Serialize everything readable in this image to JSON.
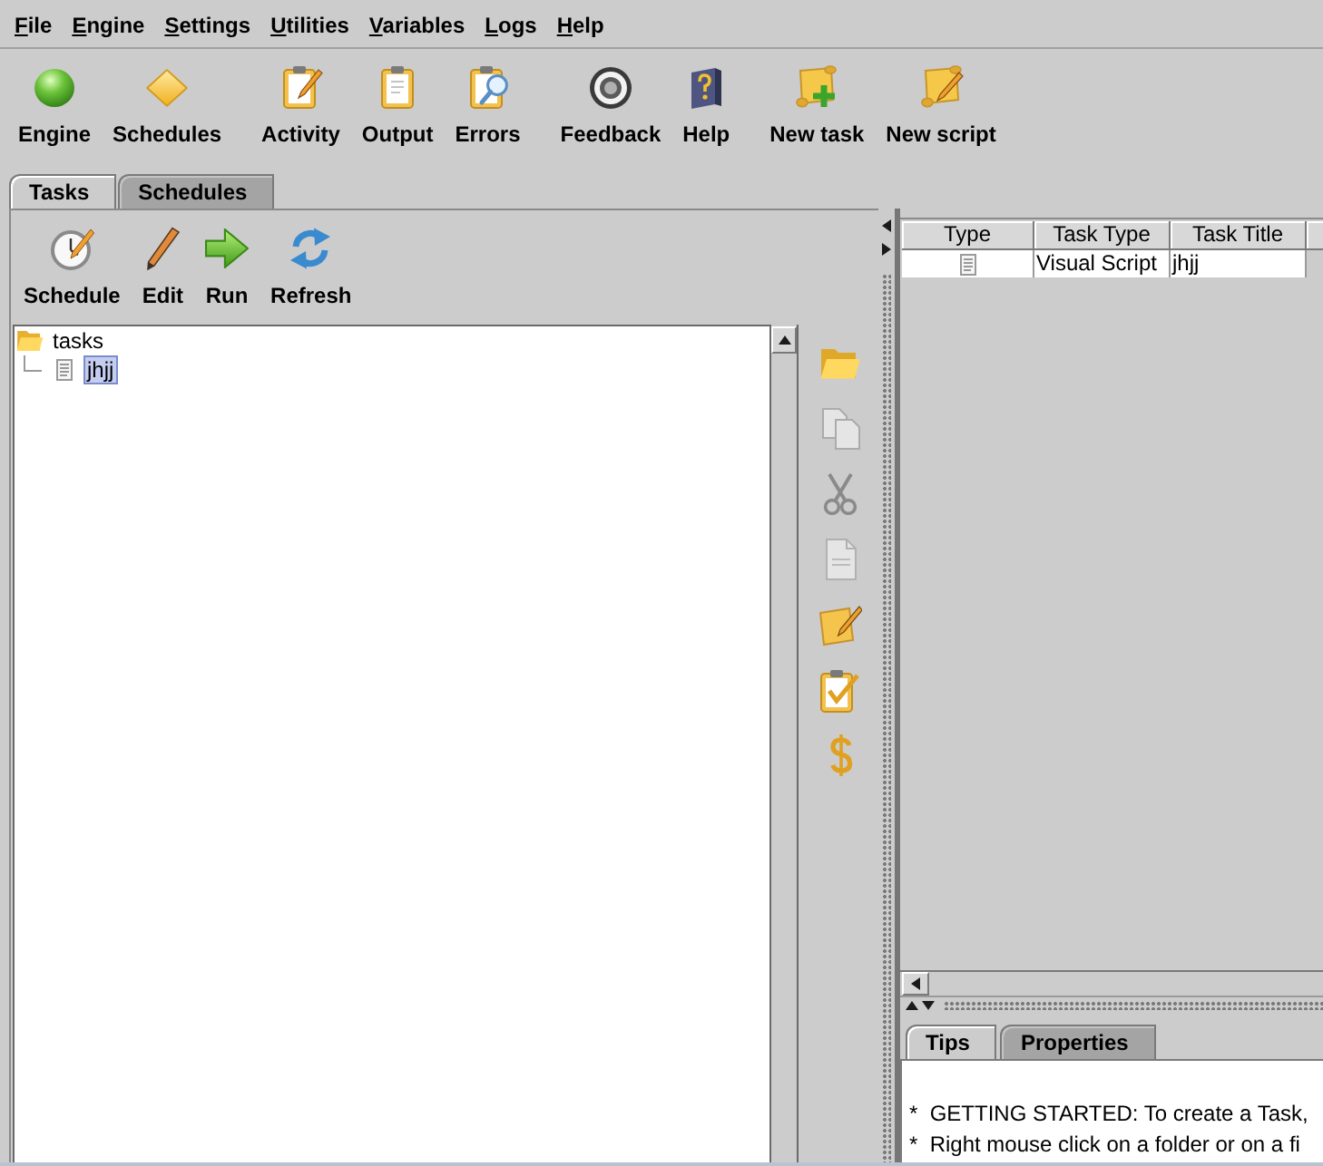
{
  "menu_bar": {
    "items": [
      "File",
      "Engine",
      "Settings",
      "Utilities",
      "Variables",
      "Logs",
      "Help"
    ]
  },
  "toolbar": {
    "groups": [
      {
        "buttons": [
          {
            "label": "Engine"
          },
          {
            "label": "Schedules"
          }
        ]
      },
      {
        "buttons": [
          {
            "label": "Activity"
          },
          {
            "label": "Output"
          },
          {
            "label": "Errors"
          }
        ]
      },
      {
        "buttons": [
          {
            "label": "Feedback"
          },
          {
            "label": "Help"
          }
        ]
      },
      {
        "buttons": [
          {
            "label": "New task"
          },
          {
            "label": "New script"
          }
        ]
      }
    ]
  },
  "main_tabs": [
    {
      "label": "Tasks",
      "selected": true
    },
    {
      "label": "Schedules",
      "selected": false
    }
  ],
  "tasks_panel": {
    "toolbar": [
      {
        "label": "Schedule"
      },
      {
        "label": "Edit"
      },
      {
        "label": "Run"
      },
      {
        "label": "Refresh"
      }
    ],
    "tree": {
      "label": "tasks",
      "expanded": true,
      "selected": false,
      "children": [
        {
          "label": "jhjj",
          "selected": true
        }
      ]
    },
    "side_tools": [
      {
        "disabled": false
      },
      {
        "disabled": true
      },
      {
        "disabled": true
      },
      {
        "disabled": true
      },
      {
        "disabled": false
      },
      {
        "disabled": false
      },
      {
        "disabled": false
      }
    ]
  },
  "task_table": {
    "columns": [
      "Type",
      "Task Type",
      "Task Title"
    ],
    "rows": [
      {
        "task_type": "Visual Script",
        "task_title": "jhjj"
      }
    ]
  },
  "bottom_tabs": [
    {
      "label": "Tips",
      "selected": true
    },
    {
      "label": "Properties",
      "selected": false
    }
  ],
  "tips": [
    "*  GETTING STARTED: To create a Task,",
    "*  Right mouse click on a folder or on a fi"
  ]
}
